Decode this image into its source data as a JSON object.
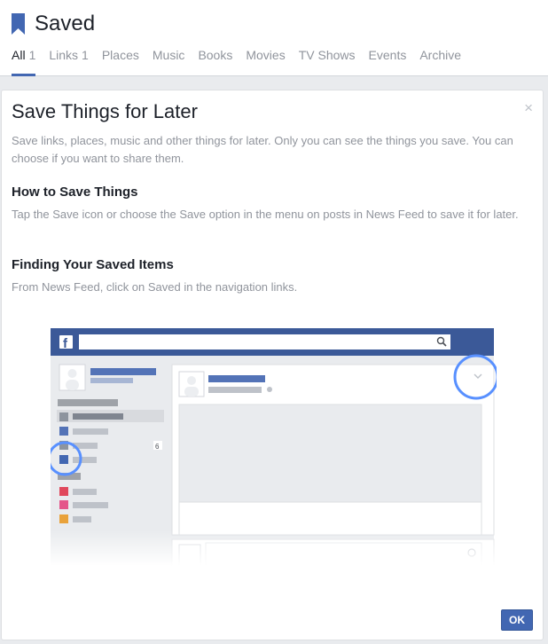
{
  "header": {
    "title": "Saved",
    "tabs": [
      {
        "label": "All",
        "count": "1",
        "active": true
      },
      {
        "label": "Links",
        "count": "1"
      },
      {
        "label": "Places"
      },
      {
        "label": "Music"
      },
      {
        "label": "Books"
      },
      {
        "label": "Movies"
      },
      {
        "label": "TV Shows"
      },
      {
        "label": "Events"
      },
      {
        "label": "Archive"
      }
    ]
  },
  "card": {
    "title": "Save Things for Later",
    "intro": "Save links, places, music and other things for later. Only you can see the things you save. You can choose if you want to share them.",
    "how_title": "How to Save Things",
    "how_text": "Tap the Save icon or choose the Save option in the menu on posts in News Feed to save it for later.",
    "finding_title": "Finding Your Saved Items",
    "finding_text": "From News Feed, click on Saved in the navigation links.",
    "ok_label": "OK",
    "close_glyph": "×"
  },
  "illustration": {
    "logo_letter": "f",
    "badge_count": "6"
  },
  "colors": {
    "brand_blue": "#4267b2",
    "highlight_circle": "#5890ff",
    "muted_text": "#90949c"
  }
}
